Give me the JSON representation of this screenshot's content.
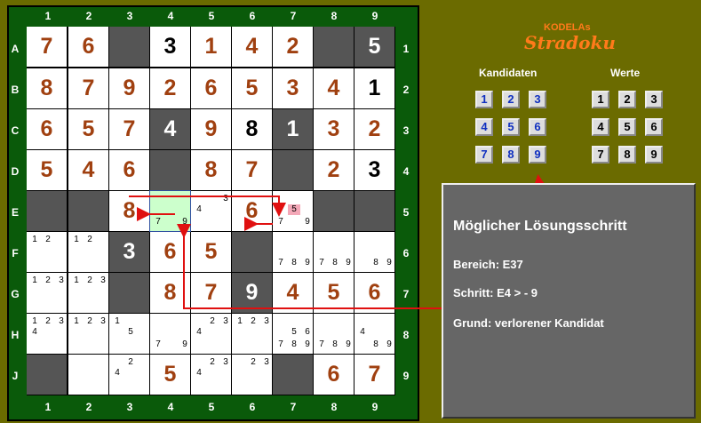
{
  "columns": [
    "1",
    "2",
    "3",
    "4",
    "5",
    "6",
    "7",
    "8",
    "9"
  ],
  "rows": [
    "A",
    "B",
    "C",
    "D",
    "E",
    "F",
    "G",
    "H",
    "J"
  ],
  "row_numbers": [
    "1",
    "2",
    "3",
    "4",
    "5",
    "6",
    "7",
    "8",
    "9"
  ],
  "brand": {
    "small": "KODELAs",
    "big": "Stradoku"
  },
  "panels": {
    "candidates_title": "Kandidaten",
    "values_title": "Werte"
  },
  "digits": [
    "1",
    "2",
    "3",
    "4",
    "5",
    "6",
    "7",
    "8",
    "9"
  ],
  "info": {
    "title": "Möglicher Lösungsschritt",
    "area": "Bereich: E37",
    "step": "Schritt:   E4 >   - 9",
    "reason": "Grund:   verlorener Kandidat"
  },
  "colors": {
    "background": "#6b6b00",
    "board": "#0a5a0a",
    "block": "#555555",
    "solved": "#a04010",
    "highlight": "#ccffcc",
    "arrow": "#e01010",
    "brand": "#ff7a1a"
  },
  "cells": [
    [
      {
        "v": "7",
        "t": "solved"
      },
      {
        "v": "6",
        "t": "solved"
      },
      {
        "b": true
      },
      {
        "v": "3",
        "t": "given-black"
      },
      {
        "v": "1",
        "t": "solved"
      },
      {
        "v": "4",
        "t": "solved"
      },
      {
        "v": "2",
        "t": "solved"
      },
      {
        "b": true
      },
      {
        "b": true,
        "v": "5",
        "t": "given-white"
      }
    ],
    [
      {
        "v": "8",
        "t": "solved"
      },
      {
        "v": "7",
        "t": "solved"
      },
      {
        "v": "9",
        "t": "solved"
      },
      {
        "v": "2",
        "t": "solved"
      },
      {
        "v": "6",
        "t": "solved"
      },
      {
        "v": "5",
        "t": "solved"
      },
      {
        "v": "3",
        "t": "solved"
      },
      {
        "v": "4",
        "t": "solved"
      },
      {
        "v": "1",
        "t": "given-black"
      }
    ],
    [
      {
        "v": "6",
        "t": "solved"
      },
      {
        "v": "5",
        "t": "solved"
      },
      {
        "v": "7",
        "t": "solved"
      },
      {
        "b": true,
        "v": "4",
        "t": "given-white"
      },
      {
        "v": "9",
        "t": "solved"
      },
      {
        "v": "8",
        "t": "given-black"
      },
      {
        "b": true,
        "v": "1",
        "t": "given-white"
      },
      {
        "v": "3",
        "t": "solved"
      },
      {
        "v": "2",
        "t": "solved"
      }
    ],
    [
      {
        "v": "5",
        "t": "solved"
      },
      {
        "v": "4",
        "t": "solved"
      },
      {
        "v": "6",
        "t": "solved"
      },
      {
        "b": true
      },
      {
        "v": "8",
        "t": "solved"
      },
      {
        "v": "7",
        "t": "solved"
      },
      {
        "b": true
      },
      {
        "v": "2",
        "t": "solved"
      },
      {
        "v": "3",
        "t": "given-black"
      }
    ],
    [
      {
        "b": true
      },
      {
        "b": true
      },
      {
        "v": "8",
        "t": "solved"
      },
      {
        "hl": true,
        "c": [
          "7",
          "9"
        ]
      },
      {
        "c": [
          "3",
          "4"
        ]
      },
      {
        "v": "6",
        "t": "solved"
      },
      {
        "c": [
          "5",
          "7",
          "9"
        ],
        "pink": "5"
      },
      {
        "b": true
      },
      {
        "b": true
      }
    ],
    [
      {
        "c": [
          "1",
          "2"
        ]
      },
      {
        "c": [
          "1",
          "2"
        ]
      },
      {
        "b": true,
        "v": "3",
        "t": "given-white"
      },
      {
        "v": "6",
        "t": "solved"
      },
      {
        "v": "5",
        "t": "solved"
      },
      {
        "b": true
      },
      {
        "c": [
          "7",
          "8",
          "9"
        ]
      },
      {
        "c": [
          "7",
          "8",
          "9"
        ]
      },
      {
        "c": [
          "8",
          "9"
        ]
      }
    ],
    [
      {
        "c": [
          "1",
          "2",
          "3"
        ]
      },
      {
        "c": [
          "1",
          "2",
          "3"
        ]
      },
      {
        "b": true
      },
      {
        "v": "8",
        "t": "solved"
      },
      {
        "v": "7",
        "t": "solved"
      },
      {
        "b": true,
        "v": "9",
        "t": "given-white"
      },
      {
        "v": "4",
        "t": "solved"
      },
      {
        "v": "5",
        "t": "solved"
      },
      {
        "v": "6",
        "t": "solved"
      }
    ],
    [
      {
        "c": [
          "1",
          "2",
          "3",
          "4"
        ]
      },
      {
        "c": [
          "1",
          "2",
          "3"
        ]
      },
      {
        "c": [
          "1",
          "5"
        ]
      },
      {
        "c": [
          "7",
          "9"
        ]
      },
      {
        "c": [
          "2",
          "3",
          "4"
        ]
      },
      {
        "c": [
          "1",
          "2",
          "3"
        ]
      },
      {
        "c": [
          "5",
          "6",
          "7",
          "8",
          "9"
        ]
      },
      {
        "c": [
          "7",
          "8",
          "9"
        ]
      },
      {
        "c": [
          "4",
          "8",
          "9"
        ]
      }
    ],
    [
      {
        "b": true
      },
      {
        "v": "8",
        "t": "given-white",
        "b2": true
      },
      {
        "c": [
          "2",
          "4"
        ]
      },
      {
        "v": "5",
        "t": "solved"
      },
      {
        "c": [
          "2",
          "3",
          "4"
        ]
      },
      {
        "c": [
          "2",
          "3"
        ]
      },
      {
        "b": true
      },
      {
        "v": "6",
        "t": "solved"
      },
      {
        "v": "7",
        "t": "solved"
      }
    ]
  ]
}
